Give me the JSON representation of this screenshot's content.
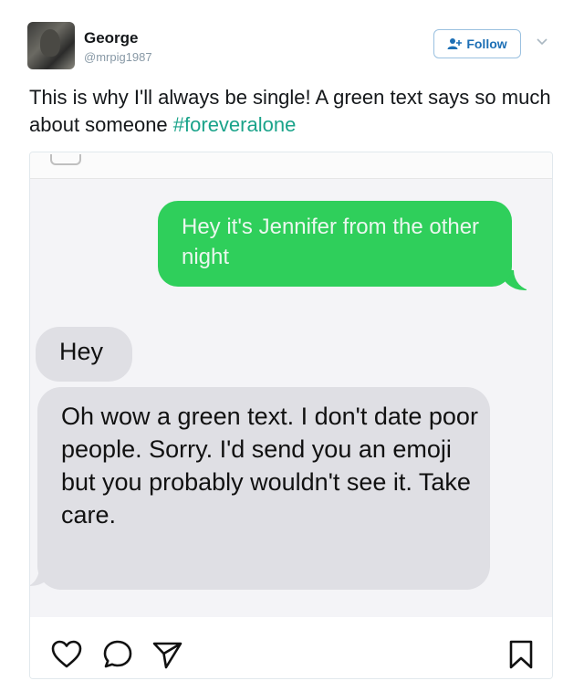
{
  "tweet": {
    "author_name": "George",
    "author_handle": "@mrpig1987",
    "follow_label": "Follow",
    "text": "This is why I'll always be single! A green text says so much about someone ",
    "hashtag": "#foreveralone",
    "colors": {
      "hashtag": "#1aa38a",
      "follow_text": "#1d6fb5"
    }
  },
  "screenshot": {
    "messages": [
      {
        "direction": "sent",
        "text": "Hey it's Jennifer from the other night",
        "color": "#2fcf5b"
      },
      {
        "direction": "received",
        "text": "Hey",
        "color": "#dfdfe4"
      },
      {
        "direction": "received",
        "text": "Oh wow a green text. I don't date poor people. Sorry. I'd send you an emoji but you probably wouldn't see it. Take care.",
        "color": "#dfdfe4"
      }
    ],
    "actions": [
      "heart-icon",
      "comment-icon",
      "share-icon",
      "bookmark-icon"
    ]
  }
}
